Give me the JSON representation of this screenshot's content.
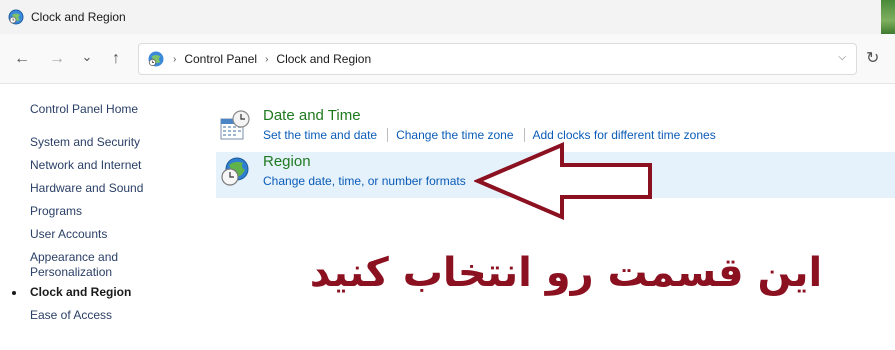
{
  "window": {
    "title": "Clock and Region"
  },
  "navigation": {
    "back_glyph": "←",
    "forward_glyph": "→",
    "recent_glyph": "⌄",
    "up_glyph": "↑",
    "refresh_glyph": "↻",
    "dropdown_glyph": "⌵"
  },
  "address_bar": {
    "separator": "›",
    "breadcrumbs": [
      "Control Panel",
      "Clock and Region"
    ]
  },
  "sidebar": {
    "items": [
      {
        "label": "Control Panel Home"
      },
      {
        "label": "System and Security"
      },
      {
        "label": "Network and Internet"
      },
      {
        "label": "Hardware and Sound"
      },
      {
        "label": "Programs"
      },
      {
        "label": "User Accounts"
      },
      {
        "label": "Appearance and Personalization"
      },
      {
        "label": "Clock and Region",
        "current": true
      },
      {
        "label": "Ease of Access"
      }
    ]
  },
  "categories": [
    {
      "title": "Date and Time",
      "icon": "calendar-clock-icon",
      "links": [
        "Set the time and date",
        "Change the time zone",
        "Add clocks for different time zones"
      ]
    },
    {
      "title": "Region",
      "icon": "globe-clock-icon",
      "links": [
        "Change date, time, or number formats"
      ],
      "highlighted": true
    }
  ],
  "annotation": {
    "text": "این قسمت رو انتخاب کنید",
    "color": "#8b1020",
    "arrow_color": "#8b1020"
  },
  "colors": {
    "link": "#0a5cb8",
    "category_title": "#1f7a1f",
    "sidebar_link": "#2a3f66",
    "highlight_row": "#e5f1fb"
  }
}
